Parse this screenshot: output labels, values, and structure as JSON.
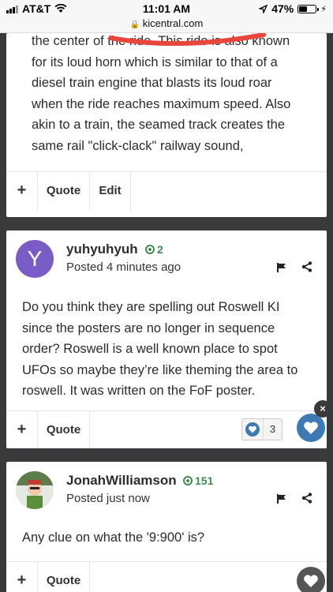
{
  "status": {
    "carrier": "AT&T",
    "time": "11:01 AM",
    "battery": "47%",
    "battery_level": 0.47,
    "url": "kicentral.com"
  },
  "post1": {
    "lines": [
      "the center of the ride. This ride is also known",
      "for its loud horn which is similar to that of a",
      "diesel train engine that blasts its loud roar",
      "when the ride reaches maximum speed. Also",
      "akin to a train, the seamed track creates the",
      "same rail \"click-clack\" railway sound,"
    ],
    "footer": {
      "plus": "+",
      "quote": "Quote",
      "edit": "Edit"
    }
  },
  "post2": {
    "avatar_letter": "Y",
    "username": "yuhyuhyuh",
    "rep": "2",
    "posted": "Posted 4 minutes ago",
    "body": "Do you think they are spelling out Roswell KI since the posters are no longer in sequence order? Roswell is a well known place to spot UFOs so maybe they’re like theming the area to roswell. It was written on the FoF poster.",
    "footer": {
      "plus": "+",
      "quote": "Quote"
    },
    "reaction_count": "3",
    "close": "×"
  },
  "post3": {
    "username": "JonahWilliamson",
    "rep": "151",
    "posted": "Posted just now",
    "body": "Any clue on what the '9:900' is?",
    "footer": {
      "plus": "+",
      "quote": "Quote"
    }
  },
  "colors": {
    "accent": "#3d79b3",
    "rep_green": "#3e8c4f",
    "avatar_purple": "#7a5cc6",
    "highlight_red": "#e8463d"
  }
}
